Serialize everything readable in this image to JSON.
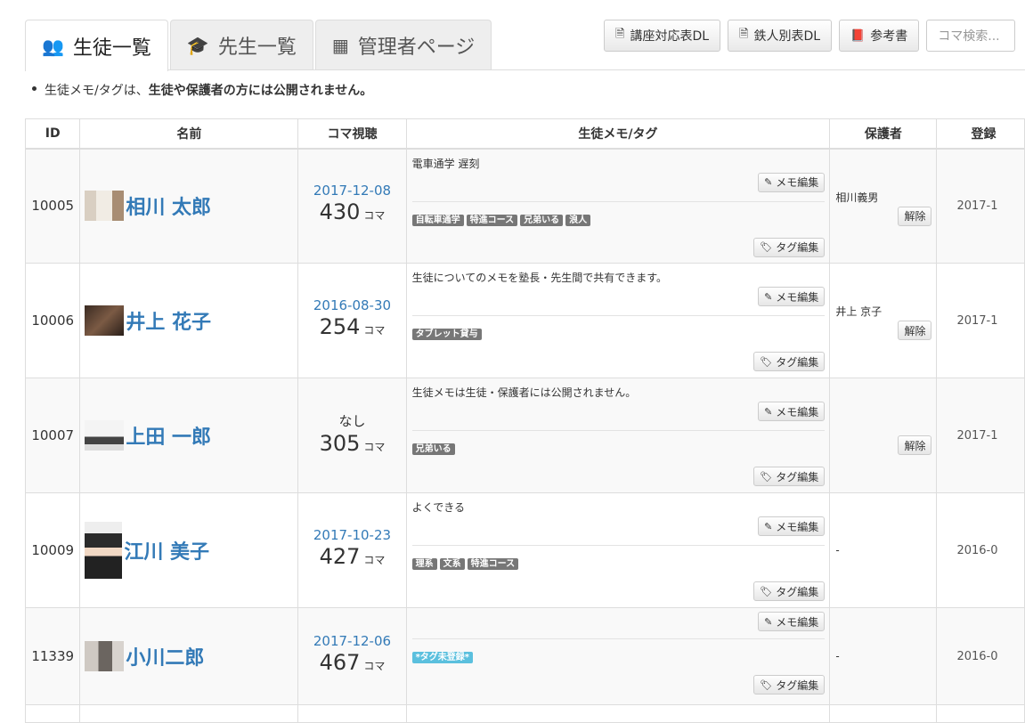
{
  "tabs": [
    {
      "label": "生徒一覧",
      "icon": "users-icon",
      "glyph": "👥"
    },
    {
      "label": "先生一覧",
      "icon": "graduation-cap-icon",
      "glyph": "🎓"
    },
    {
      "label": "管理者ページ",
      "icon": "building-icon",
      "glyph": "▦"
    }
  ],
  "toolbar": {
    "course_dl": "講座対応表DL",
    "tetsujin_dl": "鉄人別表DL",
    "reference": "参考書",
    "search_placeholder": "コマ検索..."
  },
  "notice": {
    "lead": "生徒メモ/タグは、",
    "bold": "生徒や保護者の方には公開されません。"
  },
  "columns": {
    "id": "ID",
    "name": "名前",
    "koma": "コマ視聴",
    "memo": "生徒メモ/タグ",
    "guardian": "保護者",
    "registered": "登録"
  },
  "labels": {
    "memo_edit": "メモ編集",
    "tag_edit": "タグ編集",
    "release": "解除",
    "koma_unit": "コマ"
  },
  "students": [
    {
      "id": "10005",
      "name": "相川 太郎",
      "last_view": "2017-12-08",
      "koma": "430",
      "memo": "電車通学 遅刻",
      "tags": [
        "自転車通学",
        "特進コース",
        "兄弟いる",
        "浪人"
      ],
      "guardian": "相川義男",
      "has_release": true,
      "registered": "2017-1"
    },
    {
      "id": "10006",
      "name": "井上 花子",
      "last_view": "2016-08-30",
      "koma": "254",
      "memo": "生徒についてのメモを塾長・先生間で共有できます。",
      "tags": [
        "タブレット貸与"
      ],
      "guardian": "井上 京子",
      "has_release": true,
      "registered": "2017-1"
    },
    {
      "id": "10007",
      "name": "上田 一郎",
      "last_view": "なし",
      "koma": "305",
      "memo": "生徒メモは生徒・保護者には公開されません。",
      "tags": [
        "兄弟いる"
      ],
      "guardian": "",
      "has_release": true,
      "registered": "2017-1"
    },
    {
      "id": "10009",
      "name": "江川 美子",
      "last_view": "2017-10-23",
      "koma": "427",
      "memo": "よくできる",
      "tags": [
        "理系",
        "文系",
        "特進コース"
      ],
      "guardian": "-",
      "has_release": false,
      "registered": "2016-0"
    },
    {
      "id": "11339",
      "name": "小川二郎",
      "last_view": "2017-12-06",
      "koma": "467",
      "memo": "",
      "tags": [
        "*タグ未登録*"
      ],
      "guardian": "-",
      "has_release": false,
      "registered": "2016-0"
    }
  ]
}
